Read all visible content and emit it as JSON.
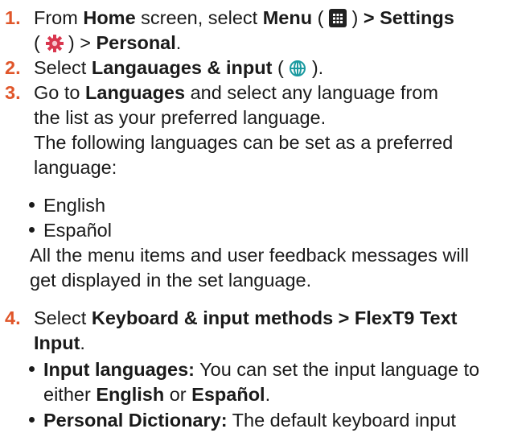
{
  "steps": [
    {
      "number": "1.",
      "t1": "From ",
      "home": "Home",
      "t2": " screen, select ",
      "menu": "Menu",
      "open1": " ( ",
      "close1": " ) ",
      "settings": "> Settings",
      "open2": "( ",
      "close2": " ) > ",
      "personal": "Personal",
      "end": "."
    },
    {
      "number": "2.",
      "t1": "Select ",
      "langs": "Langauages & input",
      "open": " ( ",
      "close": " )."
    },
    {
      "number": "3.",
      "t1": "Go to ",
      "languages": "Languages",
      "t2": " and select any language from",
      "l2": "the list as your preferred language.",
      "l3": "The following languages can be set as a preferred",
      "l4": "language:",
      "bullets": [
        "English",
        "Español"
      ],
      "after1": "All the menu items and user feedback messages will",
      "after2": "get displayed in the set language."
    },
    {
      "number": "4.",
      "t1": "Select ",
      "keyboard": "Keyboard & input methods > FlexT9 Text",
      "input": "Input",
      "end": ".",
      "b1_label": "Input languages:",
      "b1_t1": " You can set the input language to",
      "b1_t2": "either ",
      "b1_en": "English",
      "b1_or": " or ",
      "b1_es": "Español",
      "b1_end": ".",
      "b2_label": "Personal Dictionary:",
      "b2_t1": " The default keyboard input"
    }
  ],
  "icons": [
    "menu-grid-icon",
    "settings-gear-icon",
    "globe-icon"
  ],
  "colors": {
    "step_number": "#e0562a",
    "gear": "#d9374f",
    "globe": "#1a9aa0"
  }
}
